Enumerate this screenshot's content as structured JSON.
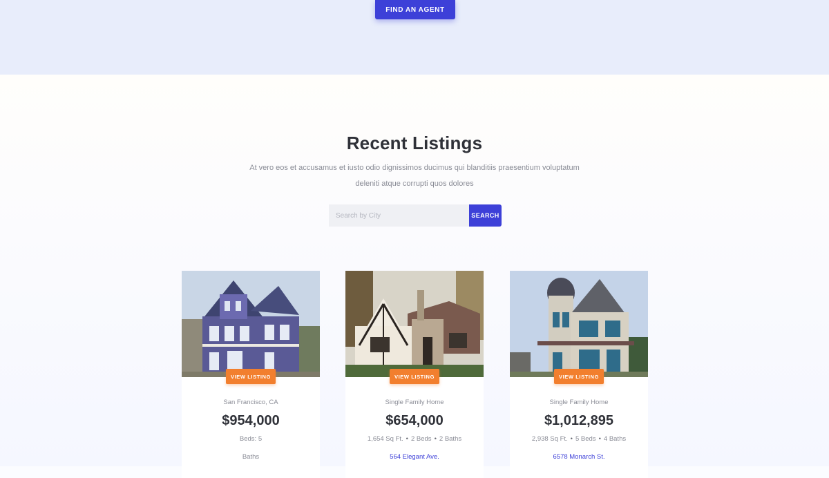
{
  "header": {
    "find_agent_label": "FIND AN AGENT"
  },
  "listings": {
    "title": "Recent Listings",
    "description": "At vero eos et accusamus et iusto odio dignissimos ducimus qui blanditiis praesentium voluptatum deleniti atque corrupti quos dolores",
    "search": {
      "placeholder": "Search by City",
      "button_label": "SEARCH"
    },
    "view_listing_label": "VIEW LISTING",
    "cards": [
      {
        "type": "San Francisco, CA",
        "price": "$954,000",
        "specs": [
          "Beds: 5"
        ],
        "extra": "Baths",
        "image": "purple-victorian-house-photo"
      },
      {
        "type": "Single Family Home",
        "price": "$654,000",
        "specs": [
          "1,654 Sq Ft.",
          "2 Beds",
          "2 Baths"
        ],
        "address": "564 Elegant Ave.",
        "image": "tudor-house-photo"
      },
      {
        "type": "Single Family Home",
        "price": "$1,012,895",
        "specs": [
          "2,938 Sq Ft.",
          "5 Beds",
          "4 Baths"
        ],
        "address": "6578 Monarch St.",
        "image": "victorian-turret-house-photo"
      }
    ]
  },
  "colors": {
    "accent": "#3d40d8",
    "cta": "#f27f2e",
    "hero_bg": "#e8edfb"
  }
}
